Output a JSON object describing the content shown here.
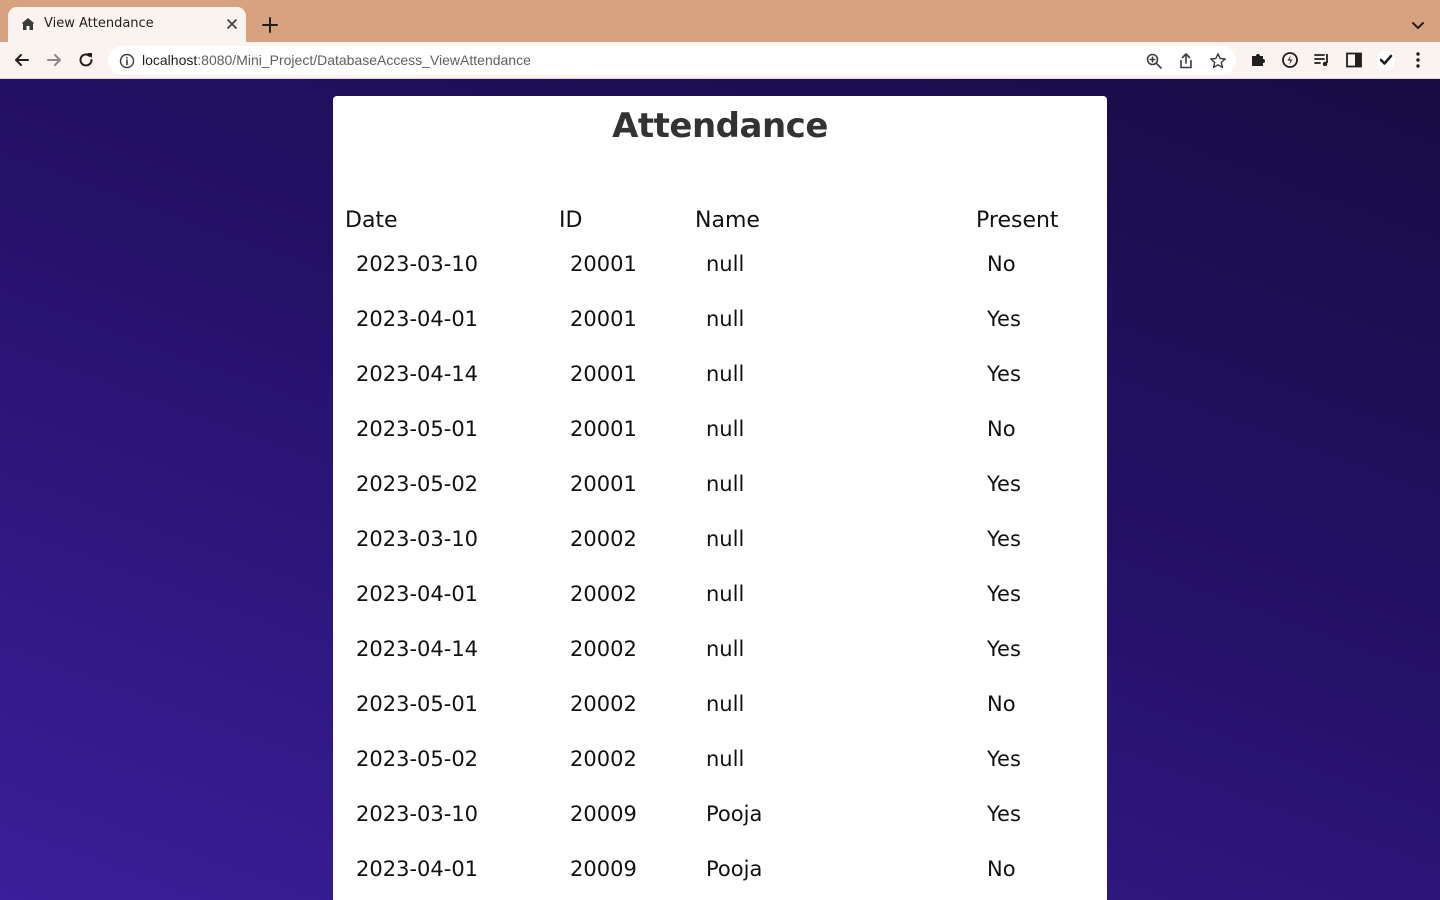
{
  "browser": {
    "tab_title": "View Attendance",
    "url_host": "localhost",
    "url_path": ":8080/Mini_Project/DatabaseAccess_ViewAttendance"
  },
  "page": {
    "title": "Attendance",
    "columns": [
      "Date",
      "ID",
      "Name",
      "Present"
    ],
    "rows": [
      {
        "date": "2023-03-10",
        "id": "20001",
        "name": "null",
        "present": "No"
      },
      {
        "date": "2023-04-01",
        "id": "20001",
        "name": "null",
        "present": "Yes"
      },
      {
        "date": "2023-04-14",
        "id": "20001",
        "name": "null",
        "present": "Yes"
      },
      {
        "date": "2023-05-01",
        "id": "20001",
        "name": "null",
        "present": "No"
      },
      {
        "date": "2023-05-02",
        "id": "20001",
        "name": "null",
        "present": "Yes"
      },
      {
        "date": "2023-03-10",
        "id": "20002",
        "name": "null",
        "present": "Yes"
      },
      {
        "date": "2023-04-01",
        "id": "20002",
        "name": "null",
        "present": "Yes"
      },
      {
        "date": "2023-04-14",
        "id": "20002",
        "name": "null",
        "present": "Yes"
      },
      {
        "date": "2023-05-01",
        "id": "20002",
        "name": "null",
        "present": "No"
      },
      {
        "date": "2023-05-02",
        "id": "20002",
        "name": "null",
        "present": "Yes"
      },
      {
        "date": "2023-03-10",
        "id": "20009",
        "name": "Pooja",
        "present": "Yes"
      },
      {
        "date": "2023-04-01",
        "id": "20009",
        "name": "Pooja",
        "present": "No"
      }
    ]
  },
  "colors": {
    "tabstrip": "#d8a180",
    "toolbar": "#fbf3ef",
    "background_dark": "#180c44",
    "background_light": "#3a1e9a",
    "title_text": "#333333"
  },
  "icons": [
    "home-icon",
    "close-icon",
    "plus-icon",
    "chevron-down-icon",
    "back-arrow-icon",
    "forward-arrow-icon",
    "reload-icon",
    "info-icon",
    "zoom-icon",
    "share-icon",
    "star-icon",
    "puzzle-icon",
    "extension-icon",
    "media-icon",
    "sidebar-icon",
    "profile-icon",
    "more-vert-icon"
  ]
}
